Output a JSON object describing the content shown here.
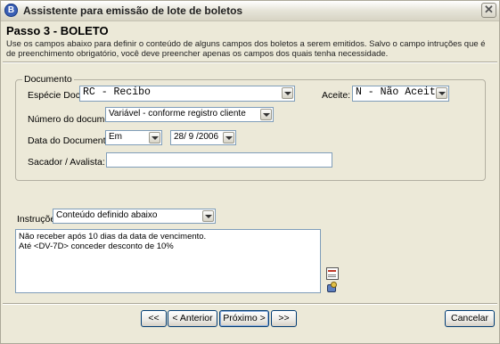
{
  "window": {
    "title": "Assistente para emissão de lote de boletos",
    "app_icon_letter": "B",
    "close_glyph": "✕"
  },
  "header": {
    "step_title": "Passo 3 - BOLETO",
    "description": "Use os campos abaixo para definir o conteúdo de alguns campos dos boletos a serem emitidos. Salvo o campo intruções que é de preenchimento obrigatório, você deve preencher apenas os campos dos quais tenha necessidade."
  },
  "documento": {
    "group_label": "Documento",
    "especie_label": "Espécie Doc:",
    "especie_value": "RC  - Recibo",
    "aceite_label": "Aceite:",
    "aceite_value": "N - Não Aceite",
    "numero_label": "Número do documento:",
    "numero_value": "Variável - conforme registro cliente",
    "data_label": "Data do Documento:",
    "data_mode_value": "Em",
    "data_value": "28/ 9 /2006",
    "sacador_label": "Sacador / Avalista:",
    "sacador_value": ""
  },
  "instrucoes": {
    "label": "Instruções:",
    "mode_value": "Conteúdo definido abaixo",
    "lines": [
      "Não receber após 10 dias da data de vencimento.",
      "Até <DV-7D> conceder desconto de 10%"
    ],
    "icons": [
      "page-lines-icon",
      "tool-settings-icon"
    ]
  },
  "footer": {
    "first_label": "<<",
    "prev_label": "< Anterior",
    "next_label": "Próximo >",
    "last_label": ">>",
    "cancel_label": "Cancelar"
  }
}
